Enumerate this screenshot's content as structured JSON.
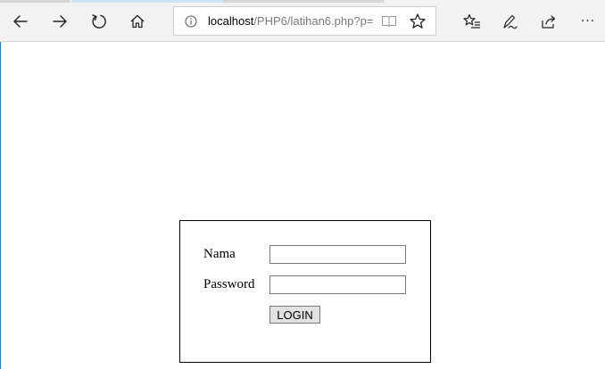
{
  "browser": {
    "address": {
      "host": "localhost",
      "path": "/PHP6/latihan6.php?p="
    },
    "icons": {
      "back": "back-arrow-icon",
      "forward": "forward-arrow-icon",
      "refresh": "refresh-icon",
      "home": "home-icon",
      "info": "info-icon",
      "reading_view": "reading-view-icon",
      "favorite": "star-icon",
      "favorites_list": "favorites-list-icon",
      "notes": "pen-icon",
      "share": "share-icon",
      "more": "more-dots-icon"
    },
    "more_label": "···"
  },
  "form": {
    "nama_label": "Nama",
    "password_label": "Password",
    "nama_value": "",
    "password_value": "",
    "login_label": "LOGIN"
  },
  "colors": {
    "toolbar_bg": "#f2f2f2",
    "accent": "#2d7dd2"
  }
}
